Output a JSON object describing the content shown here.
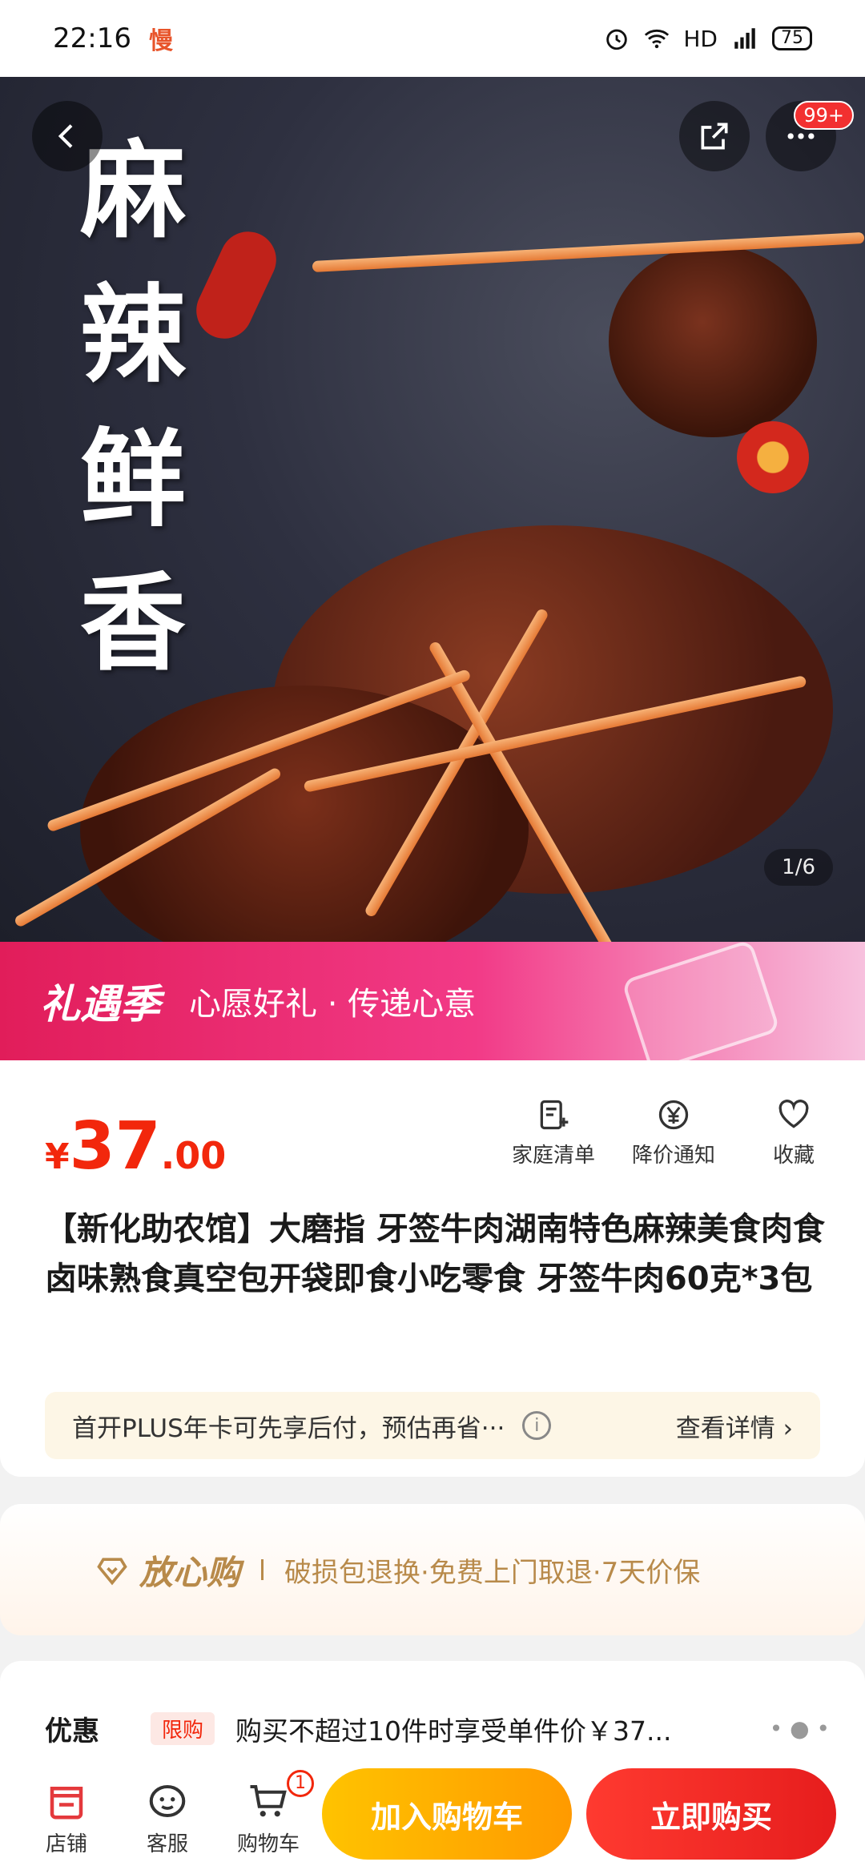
{
  "status_bar": {
    "time": "22:16",
    "app_indicator": "慢",
    "network": "HD",
    "battery": "75"
  },
  "hero": {
    "title_chars": [
      "麻",
      "辣",
      "鲜",
      "香"
    ],
    "cart_badge": "99+",
    "page_indicator": "1/6"
  },
  "promo": {
    "logo": "礼遇季",
    "text": "心愿好礼 · 传递心意"
  },
  "product": {
    "price_currency": "¥",
    "price_int": "37",
    "price_dec": ".00",
    "actions": [
      {
        "label": "家庭清单",
        "icon": "list-add-icon"
      },
      {
        "label": "降价通知",
        "icon": "price-alert-icon"
      },
      {
        "label": "收藏",
        "icon": "heart-icon"
      }
    ],
    "title": "【新化助农馆】大磨指 牙签牛肉湖南特色麻辣美食肉食卤味熟食真空包开袋即食小吃零食 牙签牛肉60克*3包",
    "plus_text": "首开PLUS年卡可先享后付，预估再省···",
    "plus_detail": "查看详情 ›"
  },
  "assurance": {
    "title": "放心购",
    "text": "破损包退换·免费上门取退·7天价保"
  },
  "offer": {
    "label": "优惠",
    "tag": "限购",
    "text": "购买不超过10件时享受单件价￥37...",
    "dots": "• ● •"
  },
  "bottom_nav": {
    "store": "店铺",
    "service": "客服",
    "cart": "购物车",
    "cart_count": "1",
    "add_to_cart": "加入购物车",
    "buy_now": "立即购买"
  }
}
